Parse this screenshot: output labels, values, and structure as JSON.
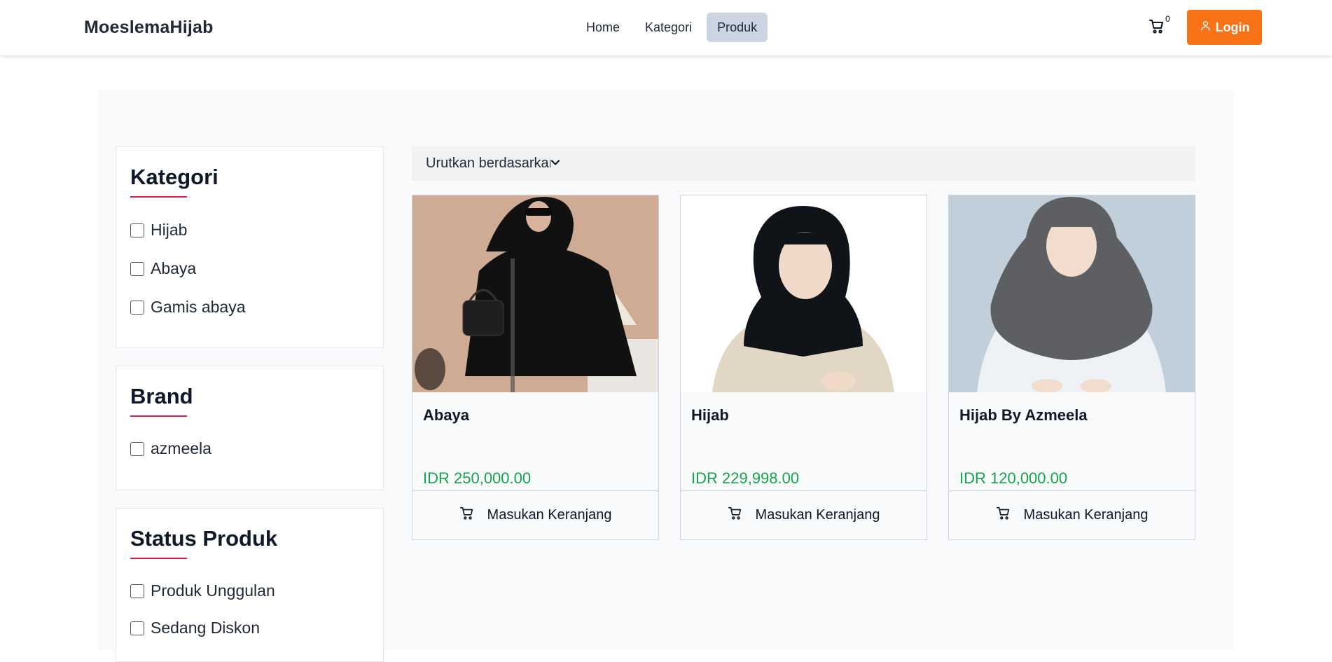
{
  "header": {
    "brand": "MoeslemaHijab",
    "nav": [
      {
        "label": "Home",
        "active": false
      },
      {
        "label": "Kategori",
        "active": false
      },
      {
        "label": "Produk",
        "active": true
      }
    ],
    "cart_count": "0",
    "cart_icon": "cart-icon",
    "login_label": "Login",
    "login_icon": "user-icon",
    "accent_color": "#f97316"
  },
  "filters": {
    "category": {
      "title": "Kategori",
      "options": [
        "Hijab",
        "Abaya",
        "Gamis abaya"
      ]
    },
    "brand": {
      "title": "Brand",
      "options": [
        "azmeela"
      ]
    },
    "status": {
      "title": "Status Produk",
      "options": [
        "Produk Unggulan",
        "Sedang Diskon"
      ]
    }
  },
  "sort": {
    "label": "Urutkan berdasarkan",
    "icon": "chevron-down-icon"
  },
  "products": [
    {
      "name": "Abaya",
      "price": "IDR 250,000.00",
      "button": "Masukan Keranjang"
    },
    {
      "name": "Hijab",
      "price": "IDR 229,998.00",
      "button": "Masukan Keranjang"
    },
    {
      "name": "Hijab By Azmeela",
      "price": "IDR 120,000.00",
      "button": "Masukan Keranjang"
    }
  ],
  "colors": {
    "price": "#16a34a",
    "title_underline": "#e11d48",
    "active_nav": "#cbd5e1"
  }
}
